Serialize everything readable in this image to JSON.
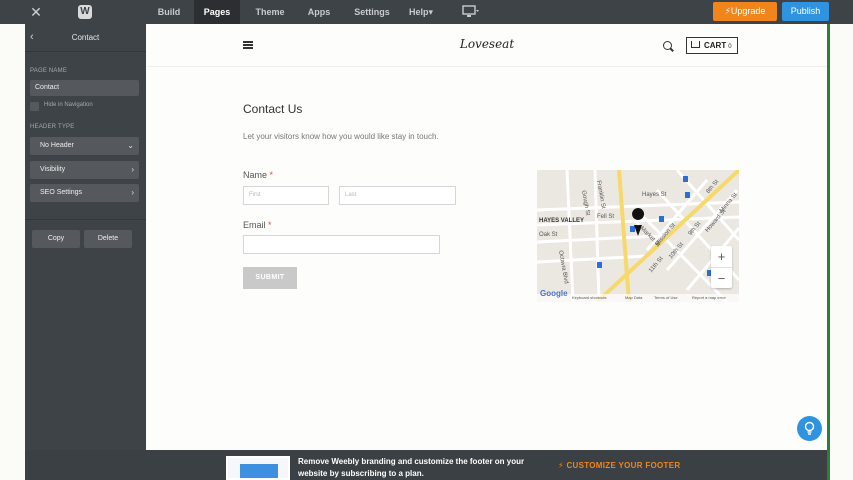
{
  "topbar": {
    "close_icon": "close-icon",
    "logo": "W",
    "tabs": [
      {
        "label": "Build",
        "active": false
      },
      {
        "label": "Pages",
        "active": true
      },
      {
        "label": "Theme",
        "active": false
      },
      {
        "label": "Apps",
        "active": false
      },
      {
        "label": "Settings",
        "active": false
      },
      {
        "label": "Help",
        "active": false
      }
    ],
    "help_suffix": "▾",
    "upgrade_label": "⚡Upgrade",
    "publish_label": "Publish"
  },
  "sidebar": {
    "title": "Contact",
    "page_name_label": "PAGE NAME",
    "page_name_value": "Contact",
    "hide_in_nav_label": "Hide in Navigation",
    "header_type_label": "HEADER TYPE",
    "header_type_value": "No Header",
    "visibility_label": "Visibility",
    "seo_label": "SEO Settings",
    "copy_label": "Copy",
    "delete_label": "Delete"
  },
  "site": {
    "title": "Loveseat",
    "cart_label": "CART",
    "cart_count": "0",
    "contact_title": "Contact Us",
    "contact_sub": "Let your visitors know how you would like stay in touch.",
    "name_label": "Name",
    "first_placeholder": "First",
    "last_placeholder": "Last",
    "email_label": "Email",
    "required_mark": "*",
    "submit_label": "SUBMIT"
  },
  "map": {
    "labels": [
      "HAYES VALLEY",
      "Hayes St",
      "Fell St",
      "Oak St",
      "Octavia Blvd",
      "Gough St",
      "Franklin St",
      "8th St",
      "9th St",
      "10th St",
      "11th St",
      "Howard St",
      "Mission St",
      "Market St",
      "Minna St"
    ],
    "google": "Google",
    "footer": [
      "Keyboard shortcuts",
      "Map Data",
      "Terms of Use",
      "Report a map error"
    ],
    "zoom_in": "+",
    "zoom_out": "−"
  },
  "footer": {
    "message": "Remove Weebly branding and customize the footer on your website by subscribing to a plan.",
    "cta": "⚡  CUSTOMIZE YOUR FOOTER"
  },
  "help_icon": "?"
}
